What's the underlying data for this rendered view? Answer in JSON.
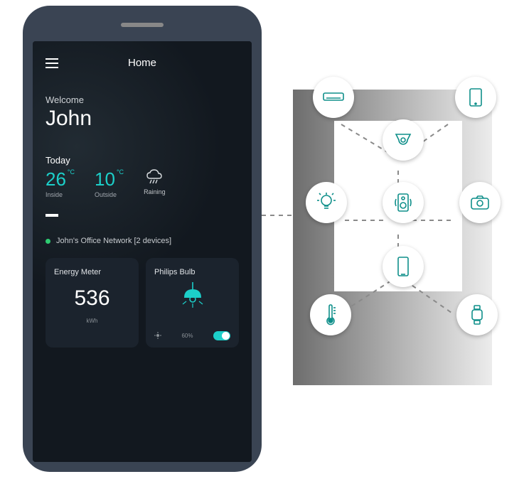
{
  "app": {
    "title": "Home",
    "welcome_label": "Welcome",
    "username": "John",
    "today_label": "Today",
    "inside": {
      "value": "26",
      "unit": "°C",
      "label": "Inside"
    },
    "outside": {
      "value": "10",
      "unit": "°C",
      "label": "Outside"
    },
    "condition": {
      "label": "Raining"
    },
    "network": {
      "status": "online",
      "text": "John's Office Network [2 devices]"
    },
    "cards": {
      "energy": {
        "title": "Energy Meter",
        "value": "536",
        "unit": "kWh"
      },
      "bulb": {
        "title": "Philips Bulb",
        "brightness": "60%",
        "toggle": true
      }
    }
  },
  "devices": [
    {
      "id": "ac",
      "name": "air-conditioner-icon"
    },
    {
      "id": "tablet",
      "name": "tablet-icon"
    },
    {
      "id": "camera-dome",
      "name": "security-camera-icon"
    },
    {
      "id": "lightbulb",
      "name": "lightbulb-icon"
    },
    {
      "id": "speaker",
      "name": "speaker-icon"
    },
    {
      "id": "camera",
      "name": "camera-icon"
    },
    {
      "id": "phone",
      "name": "smartphone-icon"
    },
    {
      "id": "thermometer",
      "name": "thermometer-icon"
    },
    {
      "id": "watch",
      "name": "smartwatch-icon"
    }
  ],
  "colors": {
    "accent": "#1ccfc9",
    "device_icon": "#0f8f8a"
  }
}
